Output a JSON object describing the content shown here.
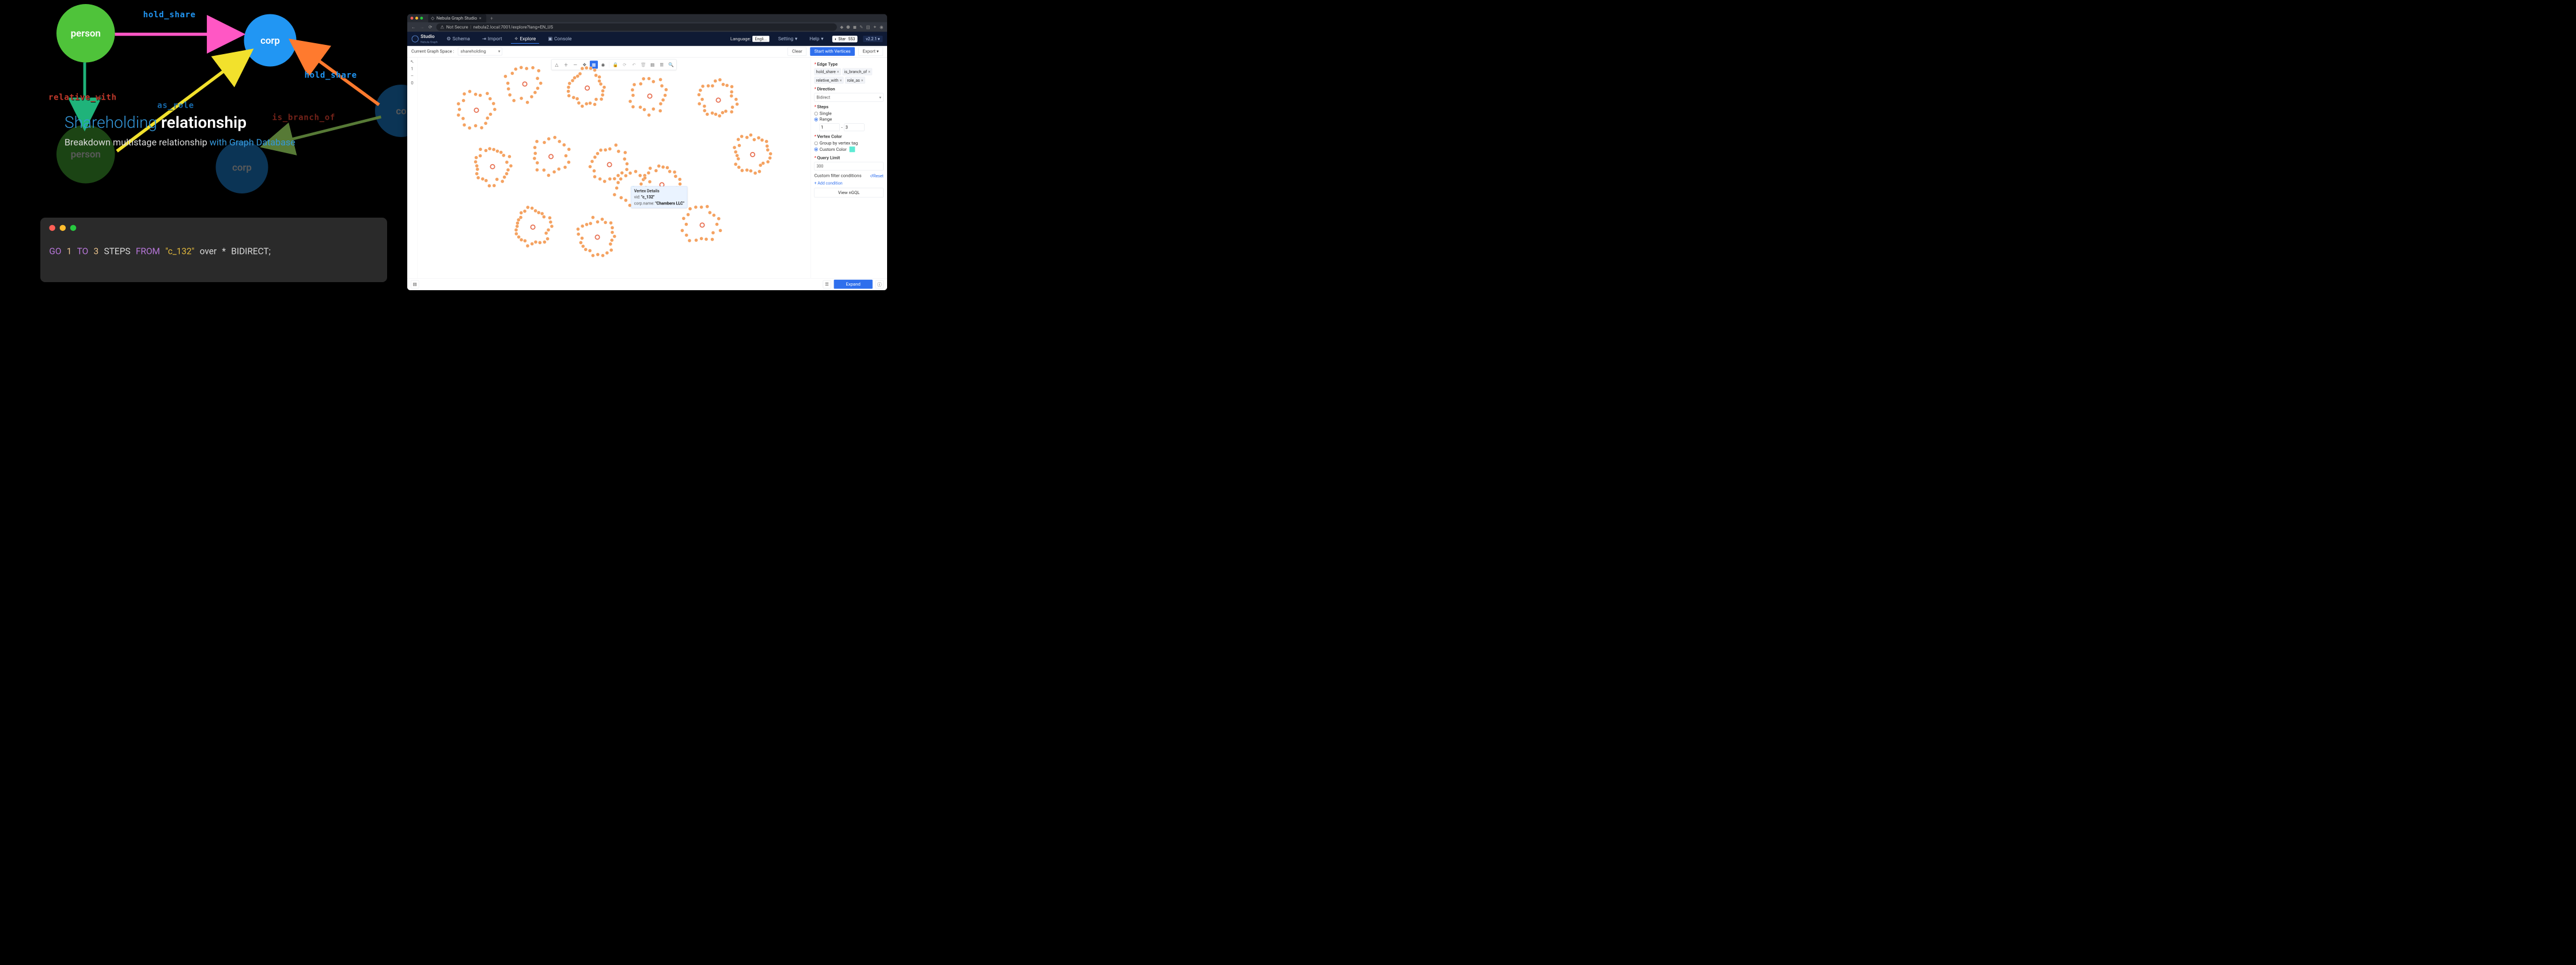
{
  "illustration": {
    "nodes": {
      "person1": "person",
      "person2": "person",
      "corp1": "corp",
      "corp2": "corp",
      "corp_edge_cut": "co"
    },
    "edges": {
      "hold_share_top": "hold_share",
      "hold_share_right": "hold_share",
      "relative_with": "relative_with",
      "as_role": "as_role",
      "is_branch_of": "is_branch_of"
    },
    "title_pre": "Shareholding ",
    "title_bold": "relationship",
    "subtitle_plain": "Breakdown multistage relationship ",
    "subtitle_em": "with Graph Database"
  },
  "terminal": {
    "code_parts": [
      "GO",
      "1",
      "TO",
      "3",
      "STEPS",
      "FROM",
      "\"c_132\"",
      "over",
      "*",
      "BIDIRECT;"
    ]
  },
  "browser": {
    "tab_title": "Nebula Graph Studio",
    "address_insecure": "Not Secure",
    "address_url": "nebula2.local:7001/explore?lang=EN_US"
  },
  "app": {
    "brand_name": "Studio",
    "brand_sub": "Nebula Graph",
    "nav": {
      "schema": "Schema",
      "import": "Import",
      "explore": "Explore",
      "console": "Console"
    },
    "language_label": "Language:",
    "language_value": "Engli...",
    "setting": "Setting",
    "help": "Help",
    "star_label": "Star",
    "star_count": "553",
    "version": "v2.2.1"
  },
  "subbar": {
    "label": "Current Graph Space :",
    "space_value": "shareholding",
    "clear": "Clear",
    "start": "Start with Vertices",
    "export": "Export"
  },
  "left_rail": [
    "↖",
    "1",
    "–",
    "0"
  ],
  "toolbox": [
    "triangle",
    "plus",
    "minus",
    "move",
    "box",
    "star",
    "sep",
    "lock",
    "refresh",
    "undo",
    "trash",
    "grid",
    "table",
    "search"
  ],
  "tooltip": {
    "title": "Vertex Details",
    "vid_key": "vid:",
    "vid_val": "\"c_132\"",
    "corp_key": "corp.name:",
    "corp_val": "\"Chambers LLC\""
  },
  "rpanel": {
    "edge_type_title": "Edge Type",
    "edge_chips": [
      "hold_share",
      "is_branch_of",
      "reletive_with",
      "role_as"
    ],
    "direction_title": "Direction",
    "direction_value": "Bidirect",
    "steps_title": "Steps",
    "steps_single": "Single",
    "steps_range": "Range",
    "steps_from": "1",
    "steps_to": "3",
    "vertex_color_title": "Vertex Color",
    "vc_group": "Group by vertex tag",
    "vc_custom": "Custom Color",
    "query_limit_title": "Query Limit",
    "query_limit_value": "300",
    "filter_title": "Custom filter conditions",
    "reset": "↺Reset",
    "add_condition": "+  Add condition",
    "view_ngql": "View nGQL"
  },
  "bottom": {
    "expand": "Expand"
  }
}
